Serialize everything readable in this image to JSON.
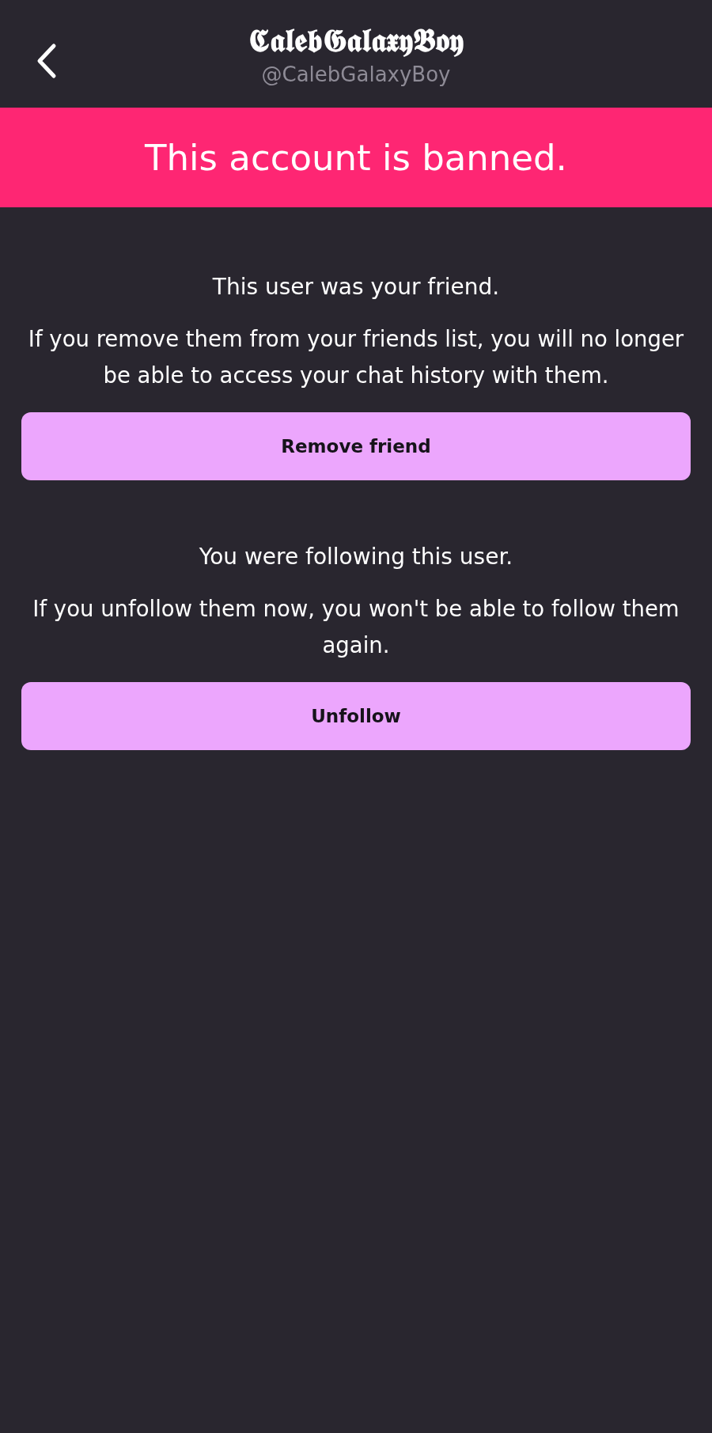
{
  "header": {
    "display_name": "𝕮𝖆𝖑𝖊𝖇𝕲𝖆𝖑𝖆𝖝𝖞𝕭𝖔𝖞",
    "handle": "@CalebGalaxyBoy"
  },
  "banner": "This account is banned.",
  "sections": [
    {
      "title": "This user was your friend.",
      "body": "If you remove them from your friends list, you will no longer be able to access your chat history with them.",
      "button": "Remove friend"
    },
    {
      "title": "You were following this user.",
      "body": "If you unfollow them now, you won't be able to follow them again.",
      "button": "Unfollow"
    }
  ]
}
